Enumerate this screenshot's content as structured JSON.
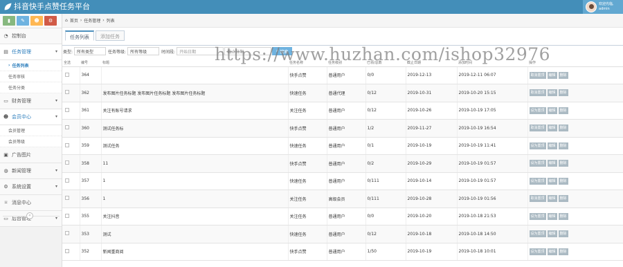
{
  "app": {
    "title": "抖音快手点赞任务平台",
    "user_greeting": "欢迎光临,",
    "user_name": "admin"
  },
  "shortcuts": [
    {
      "icon": "chart-icon",
      "color": "#87b87f"
    },
    {
      "icon": "pencil-icon",
      "color": "#6fb3e0"
    },
    {
      "icon": "users-icon",
      "color": "#ffb752"
    },
    {
      "icon": "settings-icon",
      "color": "#d15b47"
    }
  ],
  "sidebar": {
    "items": [
      {
        "label": "控制台",
        "icon": "dashboard-icon"
      },
      {
        "label": "任务管理",
        "icon": "task-icon",
        "open": true,
        "children": [
          {
            "label": "任务列表",
            "active": true
          },
          {
            "label": "任务审核"
          },
          {
            "label": "任务分类"
          }
        ]
      },
      {
        "label": "财务管理",
        "icon": "finance-icon"
      },
      {
        "label": "会员中心",
        "icon": "user-icon",
        "open": true,
        "children": [
          {
            "label": "会员管理"
          },
          {
            "label": "会员等级"
          }
        ]
      },
      {
        "label": "广告图片",
        "icon": "image-icon"
      },
      {
        "label": "新闻管理",
        "icon": "globe-icon"
      },
      {
        "label": "系统设置",
        "icon": "gear-icon"
      },
      {
        "label": "消息中心",
        "icon": "bookmark-icon"
      },
      {
        "label": "后台管理",
        "icon": "desktop-icon"
      }
    ]
  },
  "breadcrumb": {
    "home": "首页",
    "section": "任务管理",
    "current": "列表"
  },
  "tabs": [
    "任务列表",
    "添加任务"
  ],
  "filters": {
    "type_label": "类型:",
    "type_value": "所有类型",
    "level_label": "任务等级:",
    "level_value": "所有等级",
    "time_label": "时间段:",
    "start_placeholder": "开始日期",
    "end_placeholder": "截止日期",
    "search_button": "搜索"
  },
  "table": {
    "headers": [
      "全选",
      "编号",
      "标题",
      "任务名称",
      "任务级别",
      "已领/总数",
      "截止日期",
      "添加时间",
      "操作"
    ],
    "rows": [
      {
        "id": "364",
        "title": "",
        "name": "快手点赞",
        "level": "普通用户",
        "progress": "0/0",
        "deadline": "2019-12-13",
        "added": "2019-12-11 06:07",
        "actions": [
          "取消置顶",
          "编辑",
          "删除"
        ]
      },
      {
        "id": "362",
        "title": "发布图片任务标题 发布图片任务标题 发布图片任务标题",
        "name": "快速任务",
        "level": "普通代理",
        "progress": "0/12",
        "deadline": "2019-10-31",
        "added": "2019-10-20 15:15",
        "actions": [
          "取消置顶",
          "编辑",
          "删除"
        ]
      },
      {
        "id": "361",
        "title": "关注有账号请求",
        "name": "关注任务",
        "level": "普通用户",
        "progress": "0/12",
        "deadline": "2019-10-26",
        "added": "2019-10-19 17:05",
        "actions": [
          "设为置顶",
          "编辑",
          "删除"
        ]
      },
      {
        "id": "360",
        "title": "测试任务标",
        "name": "快手点赞",
        "level": "普通用户",
        "progress": "1/2",
        "deadline": "2019-11-27",
        "added": "2019-10-19 16:54",
        "actions": [
          "取消置顶",
          "编辑",
          "删除"
        ]
      },
      {
        "id": "359",
        "title": "测试任务",
        "name": "快速任务",
        "level": "普通用户",
        "progress": "0/1",
        "deadline": "2019-10-19",
        "added": "2019-10-19 11:41",
        "actions": [
          "设为置顶",
          "编辑",
          "删除"
        ]
      },
      {
        "id": "358",
        "title": "11",
        "name": "快手点赞",
        "level": "普通用户",
        "progress": "0/2",
        "deadline": "2019-10-29",
        "added": "2019-10-19 01:57",
        "actions": [
          "设为置顶",
          "编辑",
          "删除"
        ]
      },
      {
        "id": "357",
        "title": "1",
        "name": "快速任务",
        "level": "普通用户",
        "progress": "0/111",
        "deadline": "2019-10-14",
        "added": "2019-10-19 01:57",
        "actions": [
          "设为置顶",
          "编辑",
          "删除"
        ]
      },
      {
        "id": "356",
        "title": "1",
        "name": "关注任务",
        "level": "高级会员",
        "progress": "0/111",
        "deadline": "2019-10-28",
        "added": "2019-10-19 01:56",
        "actions": [
          "取消置顶",
          "编辑",
          "删除"
        ]
      },
      {
        "id": "355",
        "title": "关注抖音",
        "name": "关注任务",
        "level": "普通用户",
        "progress": "0/0",
        "deadline": "2019-10-20",
        "added": "2019-10-18 21:53",
        "actions": [
          "设为置顶",
          "编辑",
          "删除"
        ]
      },
      {
        "id": "353",
        "title": "测试",
        "name": "快速任务",
        "level": "普通用户",
        "progress": "0/12",
        "deadline": "2019-10-18",
        "added": "2019-10-18 14:50",
        "actions": [
          "设为置顶",
          "编辑",
          "删除"
        ]
      },
      {
        "id": "352",
        "title": "新闻重商阅",
        "name": "快手点赞",
        "level": "普通用户",
        "progress": "1/50",
        "deadline": "2019-10-19",
        "added": "2019-10-18 10:01",
        "actions": [
          "设为置顶",
          "编辑",
          "删除"
        ]
      }
    ]
  },
  "watermark": "https://www.huzhan.com/ishop32976"
}
